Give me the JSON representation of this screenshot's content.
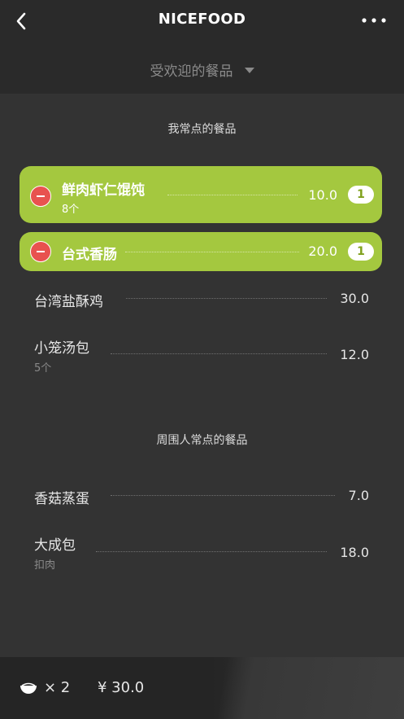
{
  "header": {
    "title": "NICEFOOD",
    "filter_label": "受欢迎的餐品"
  },
  "my_section": {
    "title": "我常点的餐品",
    "selected": [
      {
        "name": "鲜肉虾仁馄饨",
        "sub": "8个",
        "price": "10.0",
        "qty": "1"
      },
      {
        "name": "台式香肠",
        "price": "20.0",
        "qty": "1"
      }
    ],
    "items": [
      {
        "name": "台湾盐酥鸡",
        "price": "30.0"
      },
      {
        "name": "小笼汤包",
        "sub": "5个",
        "price": "12.0"
      }
    ]
  },
  "nearby_section": {
    "title": "周围人常点的餐品",
    "items": [
      {
        "name": "香菇蒸蛋",
        "price": "7.0"
      },
      {
        "name": "大成包",
        "sub": "扣肉",
        "price": "18.0"
      }
    ]
  },
  "cart": {
    "count": "× 2",
    "total": "¥ 30.0"
  },
  "colors": {
    "accent_green": "#a4c83f",
    "remove_red": "#e8524f",
    "background": "#333333"
  }
}
